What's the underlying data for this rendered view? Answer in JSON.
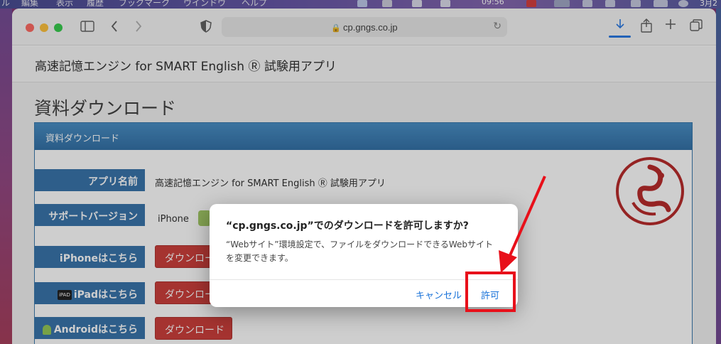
{
  "menubar": {
    "items": [
      "ル",
      "編集",
      "表示",
      "履歴",
      "ブックマーク",
      "ウインドウ",
      "ヘルプ"
    ],
    "clock": "09:56",
    "date": "3月2"
  },
  "browser": {
    "url": "cp.gngs.co.jp"
  },
  "site": {
    "title": "高速記憶エンジン for SMART English Ⓡ 試験用アプリ",
    "page_heading": "資料ダウンロード",
    "panel_heading": "資料ダウンロード",
    "rows": {
      "app_name_label": "アプリ名前",
      "app_name_value": "高速記憶エンジン for SMART English Ⓡ 試験用アプリ",
      "support_label": "サポートバージョン",
      "support_value": "iPhone",
      "iphone_label": "iPhoneはこちら",
      "ipad_tag": "iPAD",
      "ipad_label": "iPadはこちら",
      "android_label": "Androidはこちら",
      "download_button": "ダウンロード"
    }
  },
  "dialog": {
    "title": "“cp.gngs.co.jp”でのダウンロードを許可しますか?",
    "body": "“Webサイト”環境設定で、ファイルをダウンロードできるWebサイトを変更できます。",
    "cancel_label": "キャンセル",
    "allow_label": "許可"
  },
  "colors": {
    "accent_blue": "#1a73d9",
    "header_blue": "#2a6aa5",
    "download_red": "#c9312d",
    "annotation_red": "#e8101a"
  }
}
